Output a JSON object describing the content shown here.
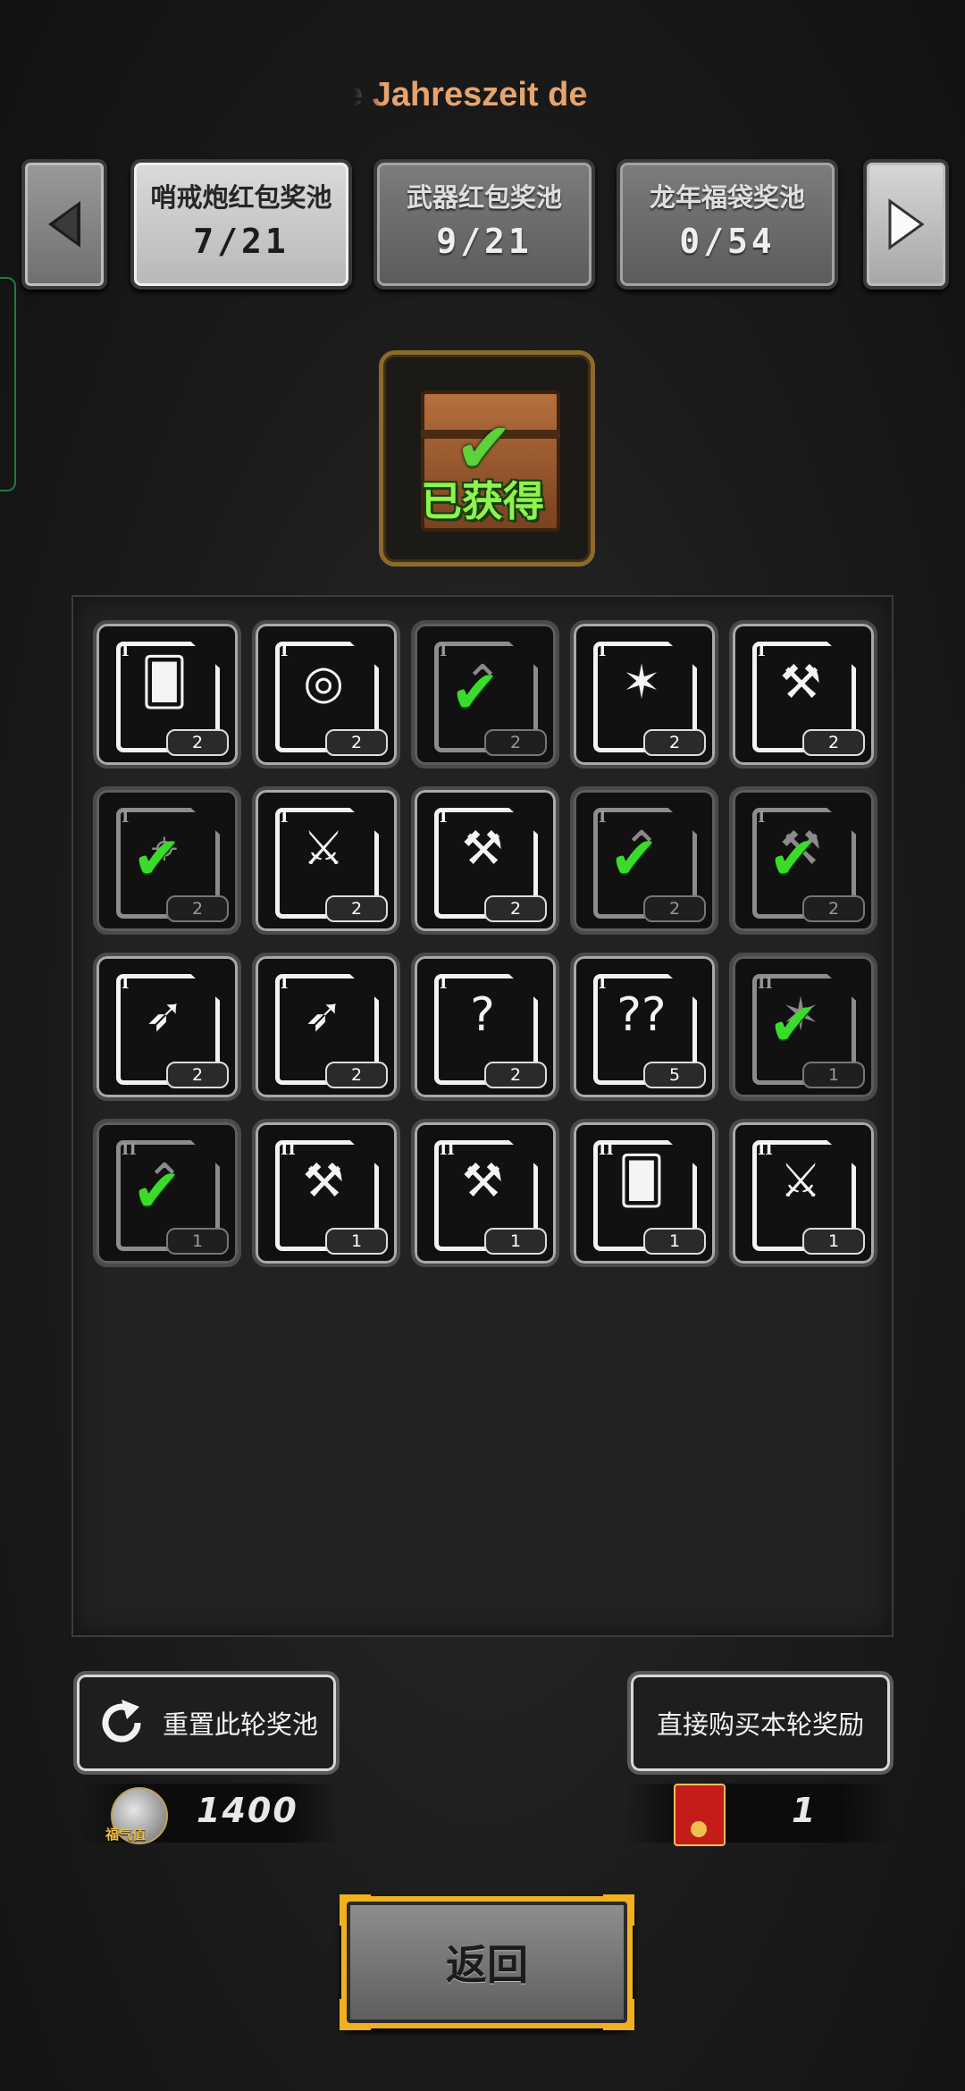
{
  "header": {
    "title_fragment": "e Jahreszeit de"
  },
  "pools": [
    {
      "name": "哨戒炮红包奖池",
      "count": "7/21",
      "active": true
    },
    {
      "name": "武器红包奖池",
      "count": "9/21",
      "active": false
    },
    {
      "name": "龙年福袋奖池",
      "count": "0/54",
      "active": false
    }
  ],
  "chest": {
    "status_label": "已获得"
  },
  "rewards": [
    {
      "tier": "I",
      "icon": "cards-icon",
      "qty": "2",
      "obtained": false
    },
    {
      "tier": "I",
      "icon": "target-icon",
      "qty": "2",
      "obtained": false
    },
    {
      "tier": "I",
      "icon": "rank-up-icon",
      "qty": "2",
      "obtained": true
    },
    {
      "tier": "I",
      "icon": "maple-leaf-icon",
      "qty": "2",
      "obtained": false
    },
    {
      "tier": "I",
      "icon": "hammer-spark-icon",
      "qty": "2",
      "obtained": false
    },
    {
      "tier": "I",
      "icon": "crosshair-icon",
      "qty": "2",
      "obtained": true
    },
    {
      "tier": "I",
      "icon": "sword-icon",
      "qty": "2",
      "obtained": false
    },
    {
      "tier": "I",
      "icon": "hammer-wing-icon",
      "qty": "2",
      "obtained": false
    },
    {
      "tier": "I",
      "icon": "rank-up-icon",
      "qty": "2",
      "obtained": true
    },
    {
      "tier": "I",
      "icon": "hammer-spark-icon",
      "qty": "2",
      "obtained": true
    },
    {
      "tier": "I",
      "icon": "bow-target-icon",
      "qty": "2",
      "obtained": false
    },
    {
      "tier": "I",
      "icon": "bow-wing-icon",
      "qty": "2",
      "obtained": false
    },
    {
      "tier": "I",
      "icon": "mystery-icon",
      "qty": "2",
      "obtained": false
    },
    {
      "tier": "I",
      "icon": "double-mystery-icon",
      "qty": "5",
      "obtained": false
    },
    {
      "tier": "II",
      "icon": "maple-leaf-icon",
      "qty": "1",
      "obtained": true
    },
    {
      "tier": "II",
      "icon": "rank-up-icon",
      "qty": "1",
      "obtained": true
    },
    {
      "tier": "II",
      "icon": "hammer-spark-icon",
      "qty": "1",
      "obtained": false
    },
    {
      "tier": "II",
      "icon": "hammer-wing-icon",
      "qty": "1",
      "obtained": false
    },
    {
      "tier": "II",
      "icon": "cards-icon",
      "qty": "1",
      "obtained": false
    },
    {
      "tier": "II",
      "icon": "sword-icon",
      "qty": "1",
      "obtained": false
    }
  ],
  "actions": {
    "reset_label": "重置此轮奖池",
    "buy_label": "直接购买本轮奖励"
  },
  "currency": {
    "fortune_label": "福气值",
    "fortune_value": "1400",
    "envelope_value": "1"
  },
  "footer": {
    "back_label": "返回"
  }
}
